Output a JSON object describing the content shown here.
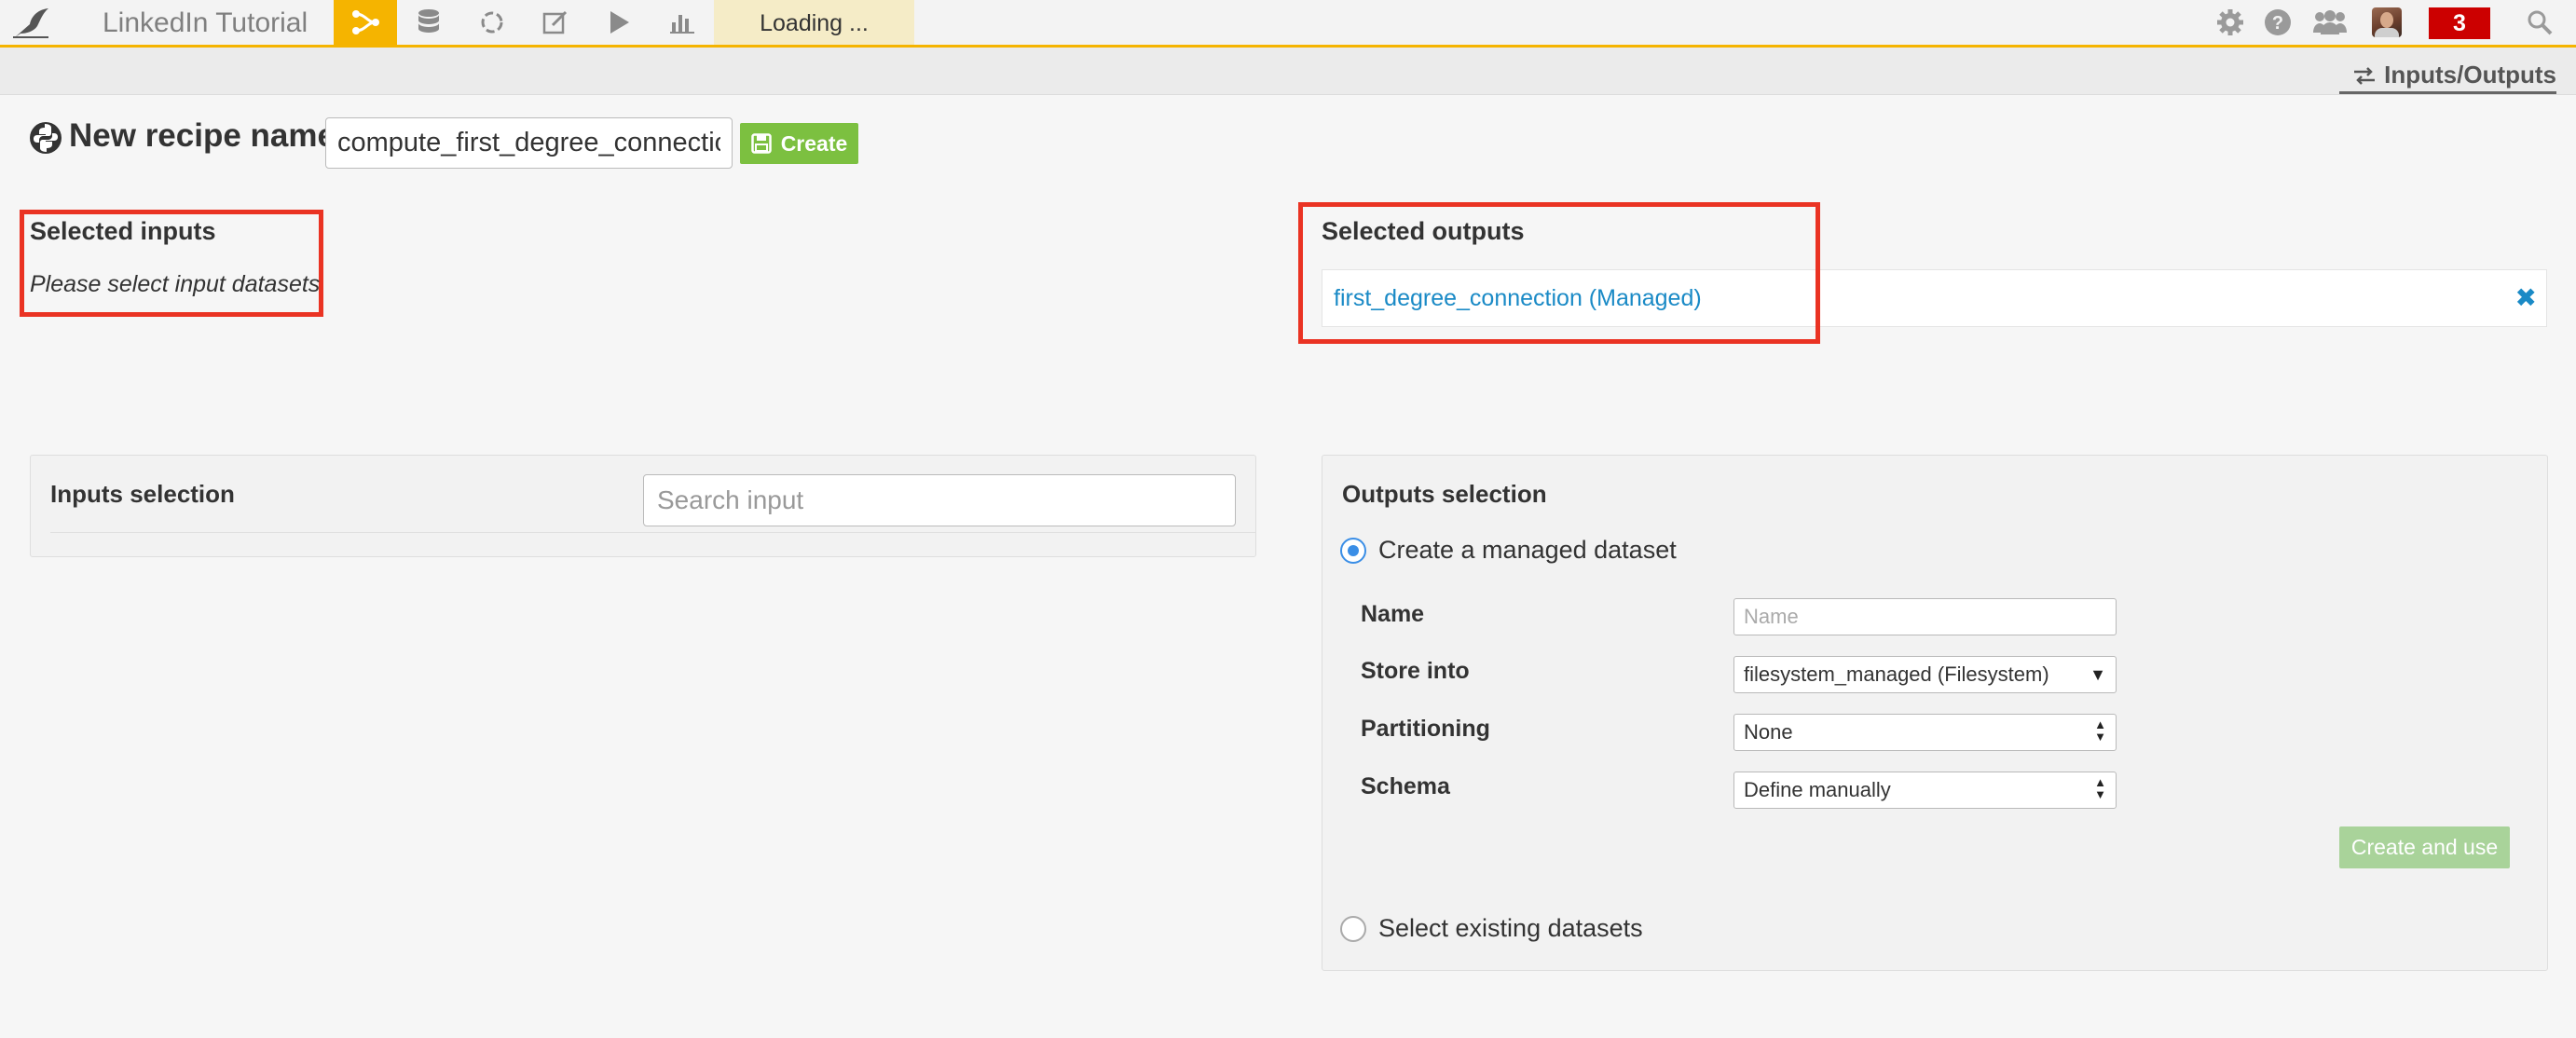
{
  "topbar": {
    "project_name": "LinkedIn Tutorial",
    "loading_text": "Loading ...",
    "notification_count": "3",
    "accent_color": "#f5b400",
    "nav_icons": [
      "flow-icon",
      "datasets-icon",
      "recipes-icon",
      "notebooks-icon",
      "jobs-icon",
      "dashboards-icon"
    ],
    "right_icons": [
      "gear-icon",
      "help-icon",
      "users-icon",
      "avatar",
      "notifications-badge",
      "search-icon"
    ]
  },
  "subbar": {
    "io_tab_label": "Inputs/Outputs"
  },
  "recipe": {
    "name_label": "New recipe name",
    "name_value": "compute_first_degree_connection",
    "create_label": "Create"
  },
  "selected_inputs": {
    "title": "Selected inputs",
    "empty_text": "Please select input datasets"
  },
  "selected_outputs": {
    "title": "Selected outputs",
    "items": [
      {
        "label": "first_degree_connection (Managed)",
        "remove": "✖"
      }
    ]
  },
  "inputs_selection": {
    "title": "Inputs selection",
    "search_placeholder": "Search input"
  },
  "outputs_selection": {
    "title": "Outputs selection",
    "option_create": "Create a managed dataset",
    "option_existing": "Select existing datasets",
    "selected_option": "Create a managed dataset",
    "form": {
      "name_label": "Name",
      "name_placeholder": "Name",
      "store_label": "Store into",
      "store_value": "filesystem_managed (Filesystem)",
      "partitioning_label": "Partitioning",
      "partitioning_value": "None",
      "schema_label": "Schema",
      "schema_value": "Define manually"
    },
    "create_use_label": "Create and use"
  },
  "highlight_color": "#ea3323"
}
